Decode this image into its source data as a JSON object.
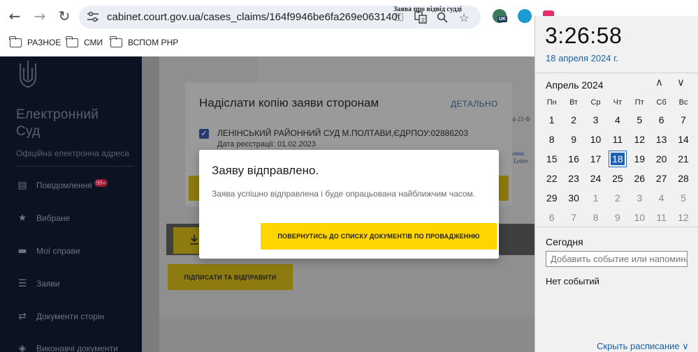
{
  "browser": {
    "url": "cabinet.court.gov.ua/cases_claims/164f9946be6fa269e063140603...",
    "ext_badge": "UK",
    "bookmarks": [
      "РАЗНОЕ",
      "СМИ",
      "ВСПОМ РНР"
    ]
  },
  "sidebar": {
    "brand_line1": "Електронний",
    "brand_line2": "Суд",
    "subtitle": "Офіційна електронна адреса",
    "items": [
      {
        "label": "Повідомлення",
        "badge": "99+",
        "icon": "message-icon"
      },
      {
        "label": "Вибране",
        "icon": "star-icon"
      },
      {
        "label": "Мої справи",
        "icon": "folder-icon"
      },
      {
        "label": "Заяви",
        "icon": "list-icon"
      },
      {
        "label": "Документи сторін",
        "icon": "swap-icon"
      },
      {
        "label": "Виконавчі документи",
        "icon": "stack-icon"
      }
    ]
  },
  "document": {
    "title": "Заява про відвід судді",
    "frag1": "4-23 Ф",
    "frag2": "аява",
    "frag3": "Letter"
  },
  "send_copy_modal": {
    "title": "Надіслати копію заяви сторонам",
    "detail_link": "ДЕТАЛЬНО",
    "recipient": "ЛЕНІНСЬКИЙ РАЙОННИЙ СУД М.ПОЛТАВИ,ЄДРПОУ:02886203",
    "reg_date": "Дата реєстрації: 01.02.2023"
  },
  "dialog": {
    "title": "Заяву відправлено.",
    "message": "Заява успішно відправлена і буде опрацьована найближчим часом.",
    "button": "ПОВЕРНУТИСЬ ДО СПИСКУ ДОКУМЕНТІВ ПО ПРОВАДЖЕННЮ"
  },
  "sign_button": "ПІДПИСАТИ ТА ВІДПРАВИТИ",
  "calendar": {
    "time": "3:26:58",
    "date": "18 апреля 2024 г.",
    "month": "Апрель 2024",
    "weekdays": [
      "Пн",
      "Вт",
      "Ср",
      "Чт",
      "Пт",
      "Сб",
      "Вс"
    ],
    "weeks": [
      [
        "1",
        "2",
        "3",
        "4",
        "5",
        "6",
        "7"
      ],
      [
        "8",
        "9",
        "10",
        "11",
        "12",
        "13",
        "14"
      ],
      [
        "15",
        "16",
        "17",
        "18",
        "19",
        "20",
        "21"
      ],
      [
        "22",
        "23",
        "24",
        "25",
        "26",
        "27",
        "28"
      ],
      [
        "29",
        "30",
        "1",
        "2",
        "3",
        "4",
        "5"
      ],
      [
        "6",
        "7",
        "8",
        "9",
        "10",
        "11",
        "12"
      ]
    ],
    "selected_day": "18",
    "today_label": "Сегодня",
    "event_placeholder": "Добавить событие или напоминание",
    "no_events": "Нет событий",
    "hide_schedule": "Скрыть расписание ∨"
  },
  "colors": {
    "accent_yellow": "#ffd500",
    "sidebar_bg": "#0c1221",
    "calendar_selected": "#1a63b8",
    "link_blue": "#1a5fa6"
  }
}
